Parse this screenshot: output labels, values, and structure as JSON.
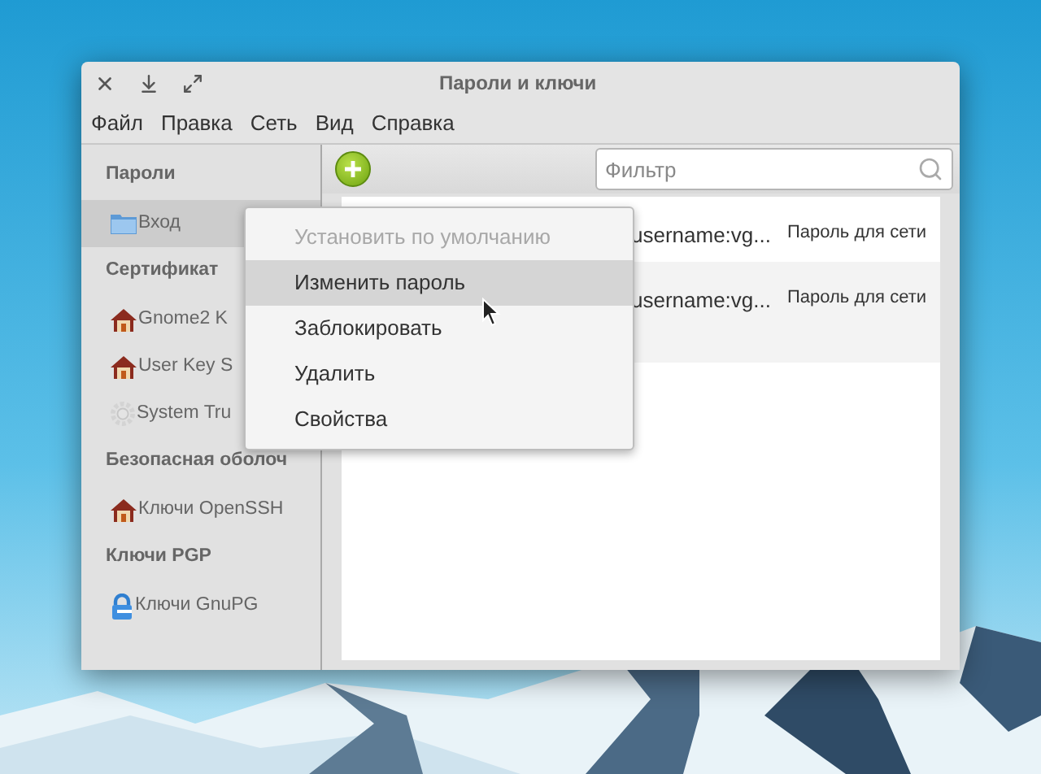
{
  "window": {
    "title": "Пароли и ключи"
  },
  "menubar": [
    "Файл",
    "Правка",
    "Сеть",
    "Вид",
    "Справка"
  ],
  "sidebar": [
    {
      "heading": "Пароли",
      "items": [
        {
          "label": "Вход",
          "kind": "folder",
          "selected": true
        }
      ]
    },
    {
      "heading": "Сертификат",
      "items": [
        {
          "label": "Gnome2 K",
          "kind": "home",
          "selected": false
        },
        {
          "label": "User Key S",
          "kind": "home",
          "selected": false
        },
        {
          "label": "System Tru",
          "kind": "gear",
          "selected": false
        }
      ]
    },
    {
      "heading": "Безопасная оболоч",
      "items": [
        {
          "label": "Ключи OpenSSH",
          "kind": "home",
          "selected": false
        }
      ]
    },
    {
      "heading": "Ключи PGP",
      "items": [
        {
          "label": "Ключи GnuPG",
          "kind": "lock",
          "selected": false
        }
      ]
    }
  ],
  "search": {
    "placeholder": "Фильтр"
  },
  "rows": [
    {
      "name": "username:vg...",
      "type": "Пароль для сети"
    },
    {
      "name": "username:vg...",
      "type": "Пароль для сети"
    }
  ],
  "context_menu": [
    {
      "label": "Установить по умолчанию",
      "disabled": true,
      "selected": false
    },
    {
      "label": "Изменить пароль",
      "disabled": false,
      "selected": true
    },
    {
      "label": "Заблокировать",
      "disabled": false,
      "selected": false
    },
    {
      "label": "Удалить",
      "disabled": false,
      "selected": false
    },
    {
      "label": "Свойства",
      "disabled": false,
      "selected": false
    }
  ]
}
